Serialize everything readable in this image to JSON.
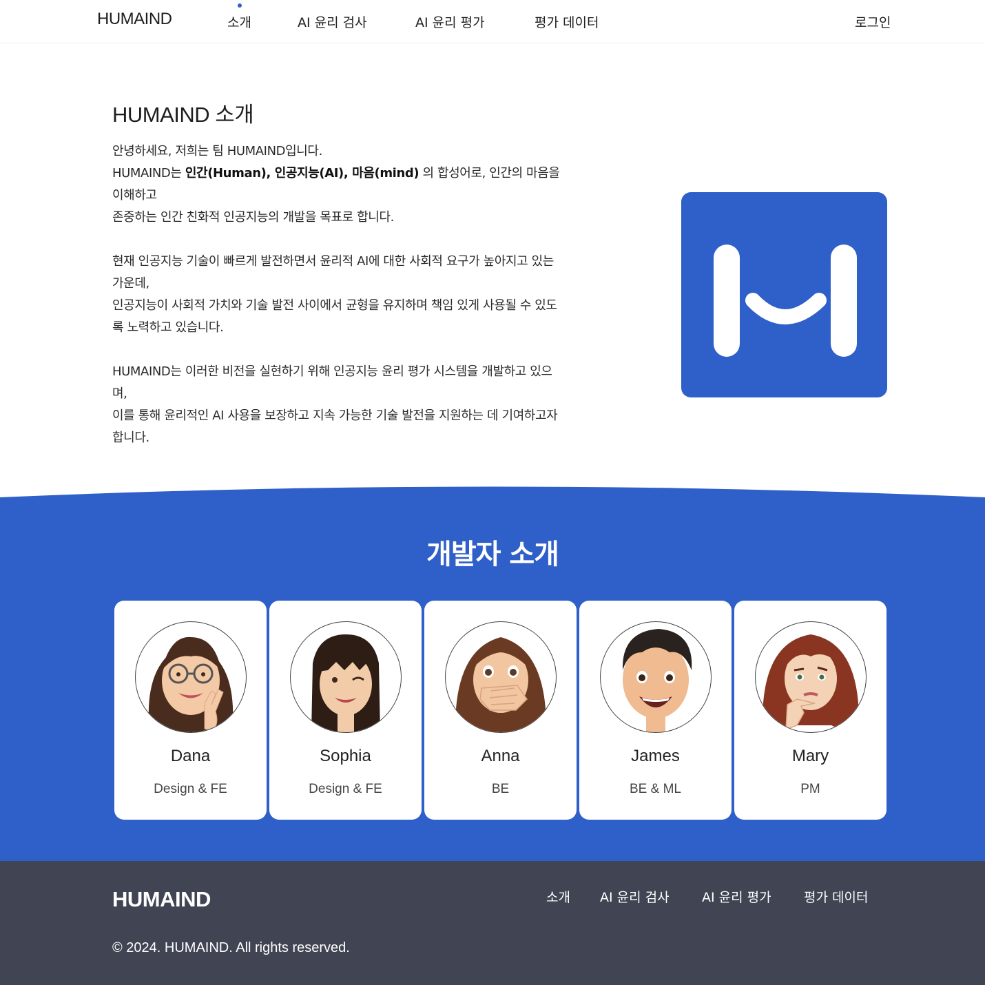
{
  "header": {
    "logo": "HUMAIND",
    "nav": [
      {
        "label": "소개",
        "active": true
      },
      {
        "label": "AI 윤리 검사"
      },
      {
        "label": "AI 윤리 평가"
      },
      {
        "label": "평가 데이터"
      }
    ],
    "login": "로그인"
  },
  "intro": {
    "title": "HUMAIND 소개",
    "p1_line1": "안녕하세요, 저희는 팀 HUMAIND입니다.",
    "p1_line2_start": "HUMAIND는 ",
    "p1_bold1": "인간(Human), 인공지능(AI), 마음(mind)",
    "p1_line2_end": " 의 합성어로, 인간의 마음을 이해하고",
    "p1_line3": "존중하는 인간 친화적 인공지능의 개발을 목표로 합니다.",
    "p2_line1": "현재 인공지능 기술이 빠르게 발전하면서 윤리적 AI에 대한 사회적 요구가 높아지고 있는 가운데,",
    "p2_line2": "인공지능이 사회적 가치와 기술 발전 사이에서 균형을 유지하며 책임 있게 사용될 수 있도록 노력하고 있습니다.",
    "p3_line1": "HUMAIND는 이러한 비전을 실현하기 위해 인공지능 윤리 평가 시스템을 개발하고 있으며,",
    "p3_line2": "이를 통해 윤리적인 AI 사용을 보장하고 지속 가능한 기술 발전을 지원하는 데 기여하고자 합니다."
  },
  "developers": {
    "title": "개발자 소개",
    "members": [
      {
        "name": "Dana",
        "role": "Design & FE"
      },
      {
        "name": "Sophia",
        "role": "Design & FE"
      },
      {
        "name": "Anna",
        "role": "BE"
      },
      {
        "name": "James",
        "role": "BE & ML"
      },
      {
        "name": "Mary",
        "role": "PM"
      }
    ]
  },
  "footer": {
    "logo": "HUMAIND",
    "links": [
      "소개",
      "AI 윤리 검사",
      "AI 윤리 평가",
      "평가 데이터"
    ],
    "copyright": "© 2024. HUMAIND. All rights reserved."
  },
  "colors": {
    "brand": "#2f5fc8",
    "footer_bg": "#414553"
  },
  "icons": [
    "humaind-logo-icon",
    "avatar-dana",
    "avatar-sophia",
    "avatar-anna",
    "avatar-james",
    "avatar-mary"
  ]
}
